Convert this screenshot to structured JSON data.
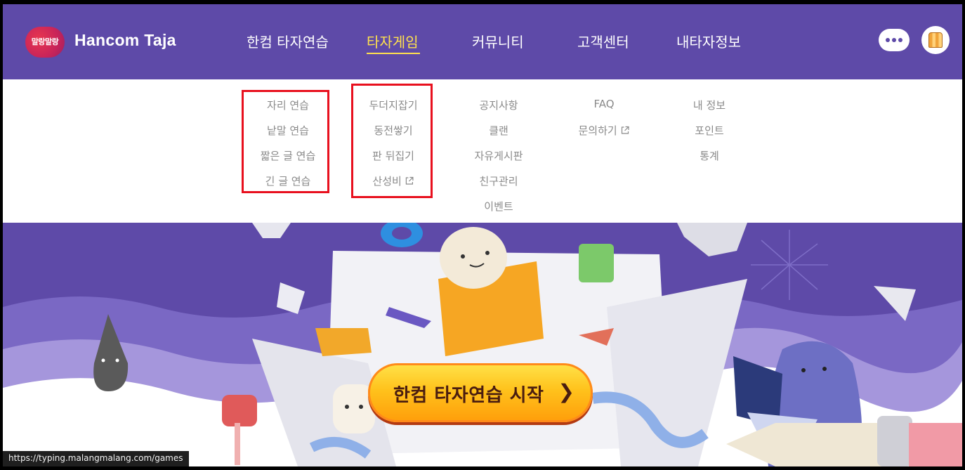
{
  "brand": {
    "badge_text": "말랑말랑",
    "name": "Hancom Taja"
  },
  "nav": [
    {
      "label": "한컴 타자연습",
      "active": false
    },
    {
      "label": "타자게임",
      "active": true
    },
    {
      "label": "커뮤니티",
      "active": false
    },
    {
      "label": "고객센터",
      "active": false
    },
    {
      "label": "내타자정보",
      "active": false
    }
  ],
  "menu": {
    "practice": [
      "자리 연습",
      "낱말 연습",
      "짧은 글 연습",
      "긴 글 연습"
    ],
    "games": [
      "두더지잡기",
      "동전쌓기",
      "판 뒤집기",
      "산성비"
    ],
    "community": [
      "공지사항",
      "클랜",
      "자유게시판",
      "친구관리",
      "이벤트"
    ],
    "support": [
      "FAQ",
      "문의하기"
    ],
    "myinfo": [
      "내 정보",
      "포인트",
      "통계"
    ]
  },
  "external_link_icon": "external-link-icon",
  "hero": {
    "cta_label": "한컴 타자연습 시작",
    "cta_arrow": "❯"
  },
  "status_bar": {
    "url": "https://typing.malangmalang.com/games"
  },
  "colors": {
    "header": "#5e4aa8",
    "active_nav": "#ffe14d",
    "highlight_box": "#e8101e",
    "cta": "#ffc21c"
  }
}
